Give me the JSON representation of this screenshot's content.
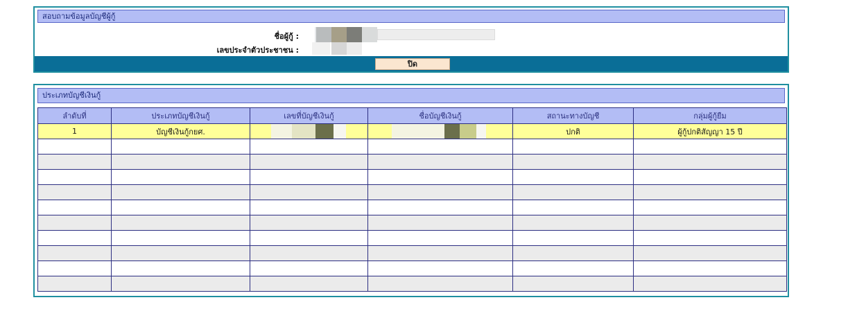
{
  "info_panel": {
    "title": "สอบถามข้อมูลบัญชีผู้กู้",
    "name_label": "ชื่อผู้กู้ :",
    "id_label": "เลขประจำตัวประชาชน :",
    "close_label": "ปิด"
  },
  "accounts_panel": {
    "title": "ประเภทบัญชีเงินกู้",
    "columns": [
      "ลำดับที่",
      "ประเภทบัญชีเงินกู้",
      "เลขที่บัญชีเงินกู้",
      "ชื่อบัญชีเงินกู้",
      "สถานะทางบัญชี",
      "กลุ่มผู้กู้ยืม"
    ],
    "rows": [
      {
        "seq": "1",
        "type": "บัญชีเงินกู้กยศ.",
        "account_no": "",
        "account_name": "",
        "status": "ปกติ",
        "group": "ผู้กู้ปกติสัญญา 15 ปี"
      }
    ]
  },
  "colors": {
    "panel_border": "#1f8fa0",
    "header_bg": "#b3bdf5",
    "action_bar": "#0a6e97",
    "highlight_row": "#ffff99",
    "button_bg": "#fbe6d0"
  }
}
